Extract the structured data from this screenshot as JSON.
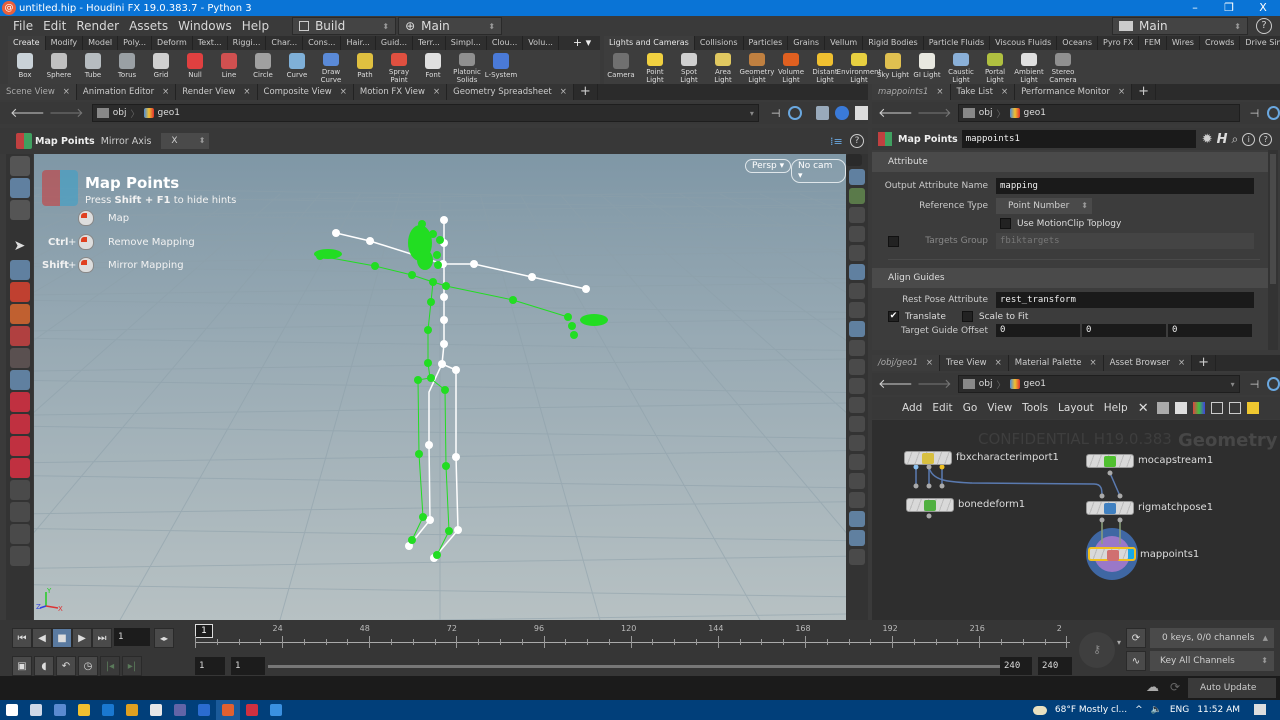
{
  "window": {
    "title": "untitled.hip - Houdini FX 19.0.383.7 - Python 3",
    "controls": [
      "–",
      "❐",
      "X"
    ]
  },
  "menubar": {
    "items": [
      "File",
      "Edit",
      "Render",
      "Assets",
      "Windows",
      "Help"
    ],
    "desktop": "Build",
    "network_desk": "Main",
    "right_desk": "Main",
    "help": "?"
  },
  "shelf_left": {
    "tabs": [
      "Create",
      "Modify",
      "Model",
      "Poly...",
      "Deform",
      "Text...",
      "Riggi...",
      "Char...",
      "Cons...",
      "Hair...",
      "Guid...",
      "Terr...",
      "Simpl...",
      "Clou...",
      "Volu..."
    ],
    "tools": [
      {
        "label": "Box",
        "color": "#c9d2d8"
      },
      {
        "label": "Sphere",
        "color": "#c0c0c0"
      },
      {
        "label": "Tube",
        "color": "#b6bcc0"
      },
      {
        "label": "Torus",
        "color": "#9aa0a4"
      },
      {
        "label": "Grid",
        "color": "#d0d0d0"
      },
      {
        "label": "Null",
        "color": "#e04040"
      },
      {
        "label": "Line",
        "color": "#d05050"
      },
      {
        "label": "Circle",
        "color": "#a0a0a0"
      },
      {
        "label": "Curve",
        "color": "#7fb0d8"
      },
      {
        "label": "Draw Curve",
        "color": "#5a8ad8"
      },
      {
        "label": "Path",
        "color": "#e0c040"
      },
      {
        "label": "Spray Paint",
        "color": "#e05040"
      },
      {
        "label": "Font",
        "color": "#e0e0e0"
      },
      {
        "label": "Platonic Solids",
        "color": "#909090"
      },
      {
        "label": "L-System",
        "color": "#4a7ad8"
      }
    ]
  },
  "shelf_right": {
    "tabs": [
      "Lights and Cameras",
      "Collisions",
      "Particles",
      "Grains",
      "Vellum",
      "Rigid Bodies",
      "Particle Fluids",
      "Viscous Fluids",
      "Oceans",
      "Pyro FX",
      "FEM",
      "Wires",
      "Crowds",
      "Drive Simulation"
    ],
    "tools": [
      {
        "label": "Camera",
        "color": "#707070"
      },
      {
        "label": "Point Light",
        "color": "#f0d040"
      },
      {
        "label": "Spot Light",
        "color": "#d0d0d0"
      },
      {
        "label": "Area Light",
        "color": "#e0c860"
      },
      {
        "label": "Geometry Light",
        "color": "#c08040"
      },
      {
        "label": "Volume Light",
        "color": "#e06020"
      },
      {
        "label": "Distant Light",
        "color": "#f0c030"
      },
      {
        "label": "Environment Light",
        "color": "#e8d040"
      },
      {
        "label": "Sky Light",
        "color": "#e0c050"
      },
      {
        "label": "GI Light",
        "color": "#e8e8e0"
      },
      {
        "label": "Caustic Light",
        "color": "#8ab0d8"
      },
      {
        "label": "Portal Light",
        "color": "#b0c040"
      },
      {
        "label": "Ambient Light",
        "color": "#e0e0e0"
      },
      {
        "label": "Stereo Camera",
        "color": "#909090"
      }
    ]
  },
  "left_pane": {
    "tabs": [
      "Scene View",
      "Animation Editor",
      "Render View",
      "Composite View",
      "Motion FX View",
      "Geometry Spreadsheet"
    ],
    "path": [
      "obj",
      "geo1"
    ],
    "tool_label": "Map Points",
    "mirror_axis_label": "Mirror Axis",
    "mirror_axis_value": "X",
    "viewport": {
      "camera": "Persp",
      "no_cam": "No cam",
      "hud": {
        "title": "Map Points",
        "hint_prefix": "Press ",
        "hint_keys": "Shift + F1",
        "hint_suffix": " to hide hints",
        "actions": [
          {
            "modifier": "",
            "label": "Map"
          },
          {
            "modifier": "Ctrl",
            "label": "Remove Mapping"
          },
          {
            "modifier": "Shift",
            "label": "Mirror Mapping"
          }
        ]
      },
      "axis": {
        "x": "X",
        "y": "Y",
        "z": "Z"
      }
    }
  },
  "parameters": {
    "tabs": [
      "mappoints1",
      "Take List",
      "Performance Monitor"
    ],
    "path": [
      "obj",
      "geo1"
    ],
    "node_type": "Map Points",
    "node_name": "mappoints1",
    "sections": {
      "attribute": "Attribute",
      "align_guides": "Align Guides"
    },
    "output_attr_label": "Output Attribute Name",
    "output_attr_value": "mapping",
    "reference_type_label": "Reference Type",
    "reference_type_value": "Point Number",
    "use_motionclip_label": "Use MotionClip Toplogy",
    "use_motionclip_checked": false,
    "targets_group_label": "Targets Group",
    "targets_group_value": "fbiktargets",
    "rest_pose_label": "Rest Pose Attribute",
    "rest_pose_value": "rest_transform",
    "translate_label": "Translate",
    "translate_checked": true,
    "scale_to_fit_label": "Scale to Fit",
    "scale_to_fit_checked": false,
    "target_guide_offset_label": "Target Guide Offset",
    "target_guide_offset": [
      "0",
      "0",
      "0"
    ]
  },
  "network": {
    "tabs": [
      "/obj/geo1",
      "Tree View",
      "Material Palette",
      "Asset Browser"
    ],
    "path": [
      "obj",
      "geo1"
    ],
    "menu": [
      "Add",
      "Edit",
      "Go",
      "View",
      "Tools",
      "Layout",
      "Help"
    ],
    "watermark": "CONFIDENTIAL H19.0.383",
    "context": "Geometry",
    "nodes": [
      {
        "name": "fbxcharacterimport1",
        "icon_color": "#d8c040"
      },
      {
        "name": "bonedeform1",
        "icon_color": "#50b040"
      },
      {
        "name": "mocapstream1",
        "icon_color": "#50c030"
      },
      {
        "name": "rigmatchpose1",
        "icon_color": "#4080c0"
      },
      {
        "name": "mappoints1",
        "icon_color": "#d07070"
      }
    ]
  },
  "timeline": {
    "current_frame": "1",
    "ticks": [
      "24",
      "48",
      "72",
      "96",
      "120",
      "144",
      "168",
      "192",
      "216",
      "2"
    ],
    "marker": "1",
    "range_start": "1",
    "range_start2": "1",
    "range_end": "240",
    "range_end2": "240",
    "keys_status": "0 keys, 0/0 channels",
    "key_mode": "Key All Channels",
    "update_mode": "Auto Update"
  },
  "taskbar": {
    "icons": [
      {
        "name": "windows-start",
        "color": "#ffffff"
      },
      {
        "name": "task-view",
        "color": "#cfd8e8"
      },
      {
        "name": "app-chart",
        "color": "#5a8ad0"
      },
      {
        "name": "file-explorer",
        "color": "#f0c030"
      },
      {
        "name": "outlook",
        "color": "#1a78d0"
      },
      {
        "name": "chrome",
        "color": "#e0a020"
      },
      {
        "name": "app-white",
        "color": "#e8e8e8"
      },
      {
        "name": "teams",
        "color": "#6264a7"
      },
      {
        "name": "word",
        "color": "#2b6cd0"
      },
      {
        "name": "houdini",
        "color": "#e06030"
      },
      {
        "name": "app-x",
        "color": "#d03040"
      },
      {
        "name": "app-blue",
        "color": "#3a90e0"
      }
    ],
    "weather": "68°F  Mostly cl...",
    "lang": "ENG",
    "time": "11:52 AM"
  },
  "colors": {
    "titlebar": "#0a74d6",
    "taskbar": "#013f7a",
    "mapped_points": "#22dd22",
    "rest_points": "#ffffff",
    "selected_node": "#f0c020"
  }
}
